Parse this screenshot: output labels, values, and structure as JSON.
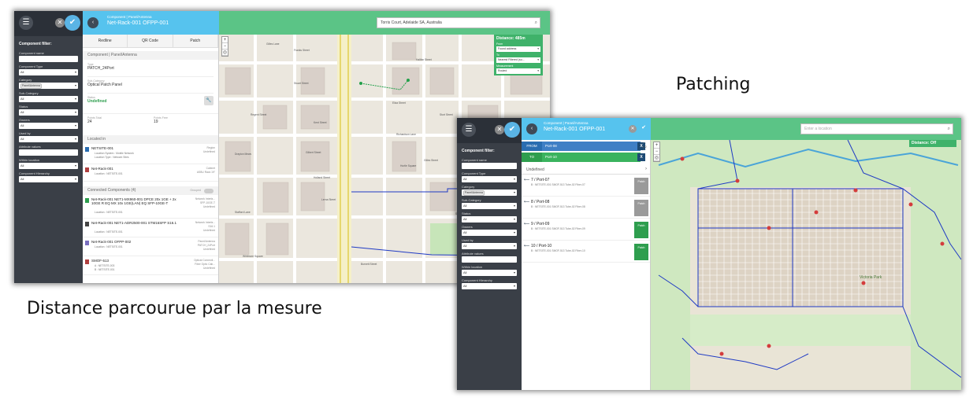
{
  "captions": {
    "distance": "Distance parcourue par la mesure",
    "patching": "Patching"
  },
  "s1": {
    "header": {
      "subtitle": "Component | Panel/Antenna",
      "title": "Net-Rack-001 OFPP-001"
    },
    "tabs": [
      "Redline",
      "QR Code",
      "Patch"
    ],
    "sidebar": {
      "title": "Component filter:",
      "fields": [
        {
          "label": "Component name",
          "value": ""
        },
        {
          "label": "Component Type",
          "value": "All"
        },
        {
          "label": "Category",
          "value": "",
          "chip": "Panel/Antenna"
        },
        {
          "label": "Sub-Category",
          "value": "All"
        },
        {
          "label": "Status",
          "value": "All"
        },
        {
          "label": "Owners",
          "value": "All"
        },
        {
          "label": "Used by",
          "value": "All"
        },
        {
          "label": "Attribute values",
          "value": ""
        },
        {
          "label": "Within location",
          "value": "All"
        },
        {
          "label": "Component Hierarchy",
          "value": "All"
        }
      ]
    },
    "detail": {
      "section": "Component | Panel/Antenna",
      "type_label": "Type",
      "type_value": "PATCH_24Port",
      "subcat_label": "Sub-Category",
      "subcat_value": "Optical Patch Panel",
      "status_label": "Status",
      "status_value": "Undefined",
      "ports_total_label": "Points Total",
      "ports_total": "24",
      "ports_free_label": "Points Free",
      "ports_free": "19",
      "located_label": "Located in",
      "located": [
        {
          "title": "NETSITE-001",
          "s1": "Location System : Mobile Network",
          "s2": "Location Type : Network Sites",
          "r1": "Region",
          "r2": "Undefined"
        },
        {
          "title": "Net-Rack-001",
          "s1": "Location : NETSITE-001",
          "s2": "",
          "r1": "Cabinet",
          "r2": "ASBU Rack 19\""
        }
      ],
      "connected_label": "Connected Components (4)",
      "grouped_label": "Grouped",
      "connected": [
        {
          "title": "Net-Rack-001 NET1-MX960-001 DPCE 20x 1GE + 2x 10GE R EQ MX 10x 1GE(LAN) EQ SFP-10GE-T",
          "s1": "Location : NETSITE-001",
          "r1": "Network Interfa...",
          "r2": "SFP-10GE-T",
          "r3": "Undefined"
        },
        {
          "title": "Net-Rack-001 NET1-ADR2500-001 STM16SFP S16.1",
          "s1": "Location : NETSITE-001",
          "r1": "Network Interfa...",
          "r2": "S16.1",
          "r3": "Undefined"
        },
        {
          "title": "Net-Rack-001 OFPP-002",
          "s1": "Location : NETSITE-001",
          "r1": "Panel/Antenna",
          "r2": "PATCH_24Port",
          "r3": "Undefined"
        },
        {
          "title": "SMOF-513",
          "s1": "A : NETSITE-003",
          "s2": "B : NETSITE-001",
          "r1": "Optical Connecti...",
          "r2": "Fiber Optic Cab...",
          "r3": "Undefined"
        }
      ]
    },
    "map": {
      "search": "Torris Court, Adelaide SA, Australia",
      "distance": {
        "title": "Distance: 485m",
        "from_label": "From",
        "from_value": "Found address",
        "to_label": "To",
        "to_value": "Nearest Filtered (su...",
        "measure_label": "Measurement",
        "measure_value": "Routed"
      },
      "streets": [
        "Gilles Lane",
        "Franks Street",
        "Halifax Street",
        "Stuart Street",
        "Eliza Street",
        "Richardson Lane",
        "Gilbert Street",
        "Drayton Mews",
        "Hurtle Square",
        "Gilles Street",
        "Holland Street",
        "Lerna Street",
        "Stafford Lane",
        "South Terrace",
        "Corryton Street",
        "Kent Street",
        "Regent Street",
        "Sturt Street",
        "Whitmore Square",
        "Burnett Street"
      ]
    }
  },
  "s2": {
    "header": {
      "subtitle": "Component | Panel/Antenna",
      "title": "Net-Rack-001 OFPP-001"
    },
    "sidebar": {
      "title": "Component filter:",
      "fields": [
        {
          "label": "Component name",
          "value": ""
        },
        {
          "label": "Component Type",
          "value": "All"
        },
        {
          "label": "Category",
          "value": "",
          "chip": "Panel/Antenna"
        },
        {
          "label": "Sub-Category",
          "value": "All"
        },
        {
          "label": "Status",
          "value": "All"
        },
        {
          "label": "Owners",
          "value": "All"
        },
        {
          "label": "Used by",
          "value": "All"
        },
        {
          "label": "Attribute values",
          "value": ""
        },
        {
          "label": "Within location",
          "value": "All"
        },
        {
          "label": "Component Hierarchy",
          "value": "All"
        }
      ]
    },
    "patch": {
      "from_label": "FROM",
      "from_port": "Port-08",
      "to_label": "TO",
      "to_port": "Port-10",
      "close": "X",
      "pager": "2/2",
      "undefined_label": "Undefined",
      "rows": [
        {
          "title": "7 / Port-07",
          "sub": "B : NETSITE-001 SMOF-513 Tube-02 Fiber-07",
          "btn": "Patch",
          "active": false
        },
        {
          "title": "8 / Port-08",
          "sub": "B : NETSITE-001 SMOF-513 Tube-02 Fiber-08",
          "btn": "Patch",
          "active": false
        },
        {
          "title": "9 / Port-09",
          "sub": "B : NETSITE-001 SMOF-513 Tube-02 Fiber-09",
          "btn": "Patch",
          "active": true
        },
        {
          "title": "10 / Port-10",
          "sub": "B : NETSITE-001 SMOF-513 Tube-02 Fiber-10",
          "btn": "Patch",
          "active": true
        }
      ]
    },
    "map": {
      "search_placeholder": "Enter a location",
      "distance": "Distance: Off",
      "park_name": "Victoria Park"
    }
  }
}
